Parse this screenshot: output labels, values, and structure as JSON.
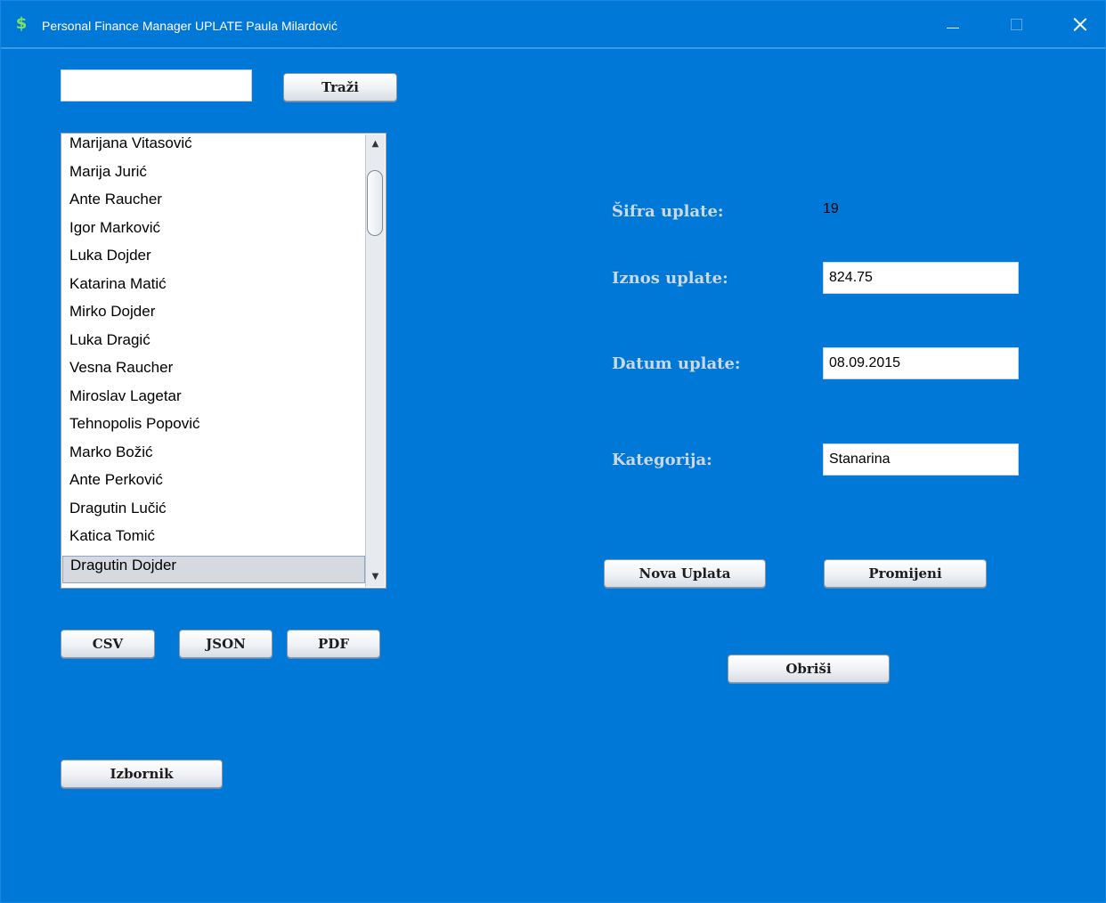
{
  "window": {
    "title": "Personal Finance Manager  UPLATE Paula Milardović",
    "icon": "dollar-icon",
    "accent": "#0078d7"
  },
  "search": {
    "value": "",
    "button_label": "Traži"
  },
  "list": {
    "items": [
      "Marijana Vitasović",
      "Marija Jurić",
      "Ante Raucher",
      "Igor Marković",
      "Luka Dojder",
      "Katarina Matić",
      "Mirko Dojder",
      "Luka Dragić",
      "Vesna Raucher",
      "Miroslav Lagetar",
      "Tehnopolis Popović",
      "Marko Božić",
      "Ante Perković",
      "Dragutin Lučić",
      "Katica Tomić",
      "Dragutin Dojder"
    ],
    "selected": "Dragutin Dojder"
  },
  "export": {
    "csv_label": "CSV",
    "json_label": "JSON",
    "pdf_label": "PDF"
  },
  "menu_button_label": "Izbornik",
  "form": {
    "sifra_label": "Šifra uplate:",
    "sifra_value": "19",
    "iznos_label": "Iznos uplate:",
    "iznos_value": "824.75",
    "datum_label": "Datum uplate:",
    "datum_value": "08.09.2015",
    "kategorija_label": "Kategorija:",
    "kategorija_value": "Stanarina"
  },
  "actions": {
    "new_label": "Nova Uplata",
    "change_label": "Promijeni",
    "delete_label": "Obriši"
  }
}
